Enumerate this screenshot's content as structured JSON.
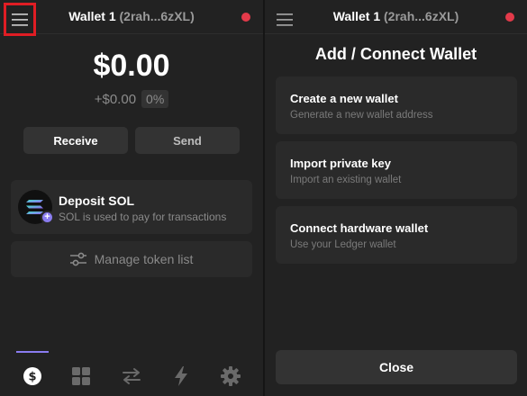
{
  "colors": {
    "background": "#222222",
    "card": "#2a2a2a",
    "accent": "#8a7cf0",
    "status_dot": "#e33a4a",
    "highlight": "#e01d24"
  },
  "left": {
    "header": {
      "wallet_name": "Wallet 1",
      "wallet_address": "(2rah...6zXL)",
      "menu_icon": "hamburger-menu-icon",
      "status_icon": "red-status-dot"
    },
    "balance": "$0.00",
    "change_value": "+$0.00",
    "change_percent": "0%",
    "buttons": {
      "receive": "Receive",
      "send": "Send"
    },
    "deposit": {
      "title": "Deposit SOL",
      "subtitle": "SOL is used to pay for transactions",
      "icon": "solana-logo-icon",
      "badge": "+"
    },
    "manage_token_list": {
      "label": "Manage token list",
      "icon": "sliders-icon"
    },
    "tabs": [
      {
        "name": "tokens",
        "icon": "dollar-icon",
        "active": true
      },
      {
        "name": "collectibles",
        "icon": "grid-icon",
        "active": false
      },
      {
        "name": "swap",
        "icon": "swap-arrows-icon",
        "active": false
      },
      {
        "name": "activity",
        "icon": "lightning-icon",
        "active": false
      },
      {
        "name": "settings",
        "icon": "gear-icon",
        "active": false
      }
    ]
  },
  "right": {
    "header": {
      "wallet_name": "Wallet 1",
      "wallet_address": "(2rah...6zXL)",
      "menu_icon": "hamburger-menu-icon",
      "status_icon": "red-status-dot"
    },
    "title": "Add / Connect Wallet",
    "options": [
      {
        "title": "Create a new wallet",
        "subtitle": "Generate a new wallet address"
      },
      {
        "title": "Import private key",
        "subtitle": "Import an existing wallet"
      },
      {
        "title": "Connect hardware wallet",
        "subtitle": "Use your Ledger wallet"
      }
    ],
    "close_label": "Close"
  }
}
